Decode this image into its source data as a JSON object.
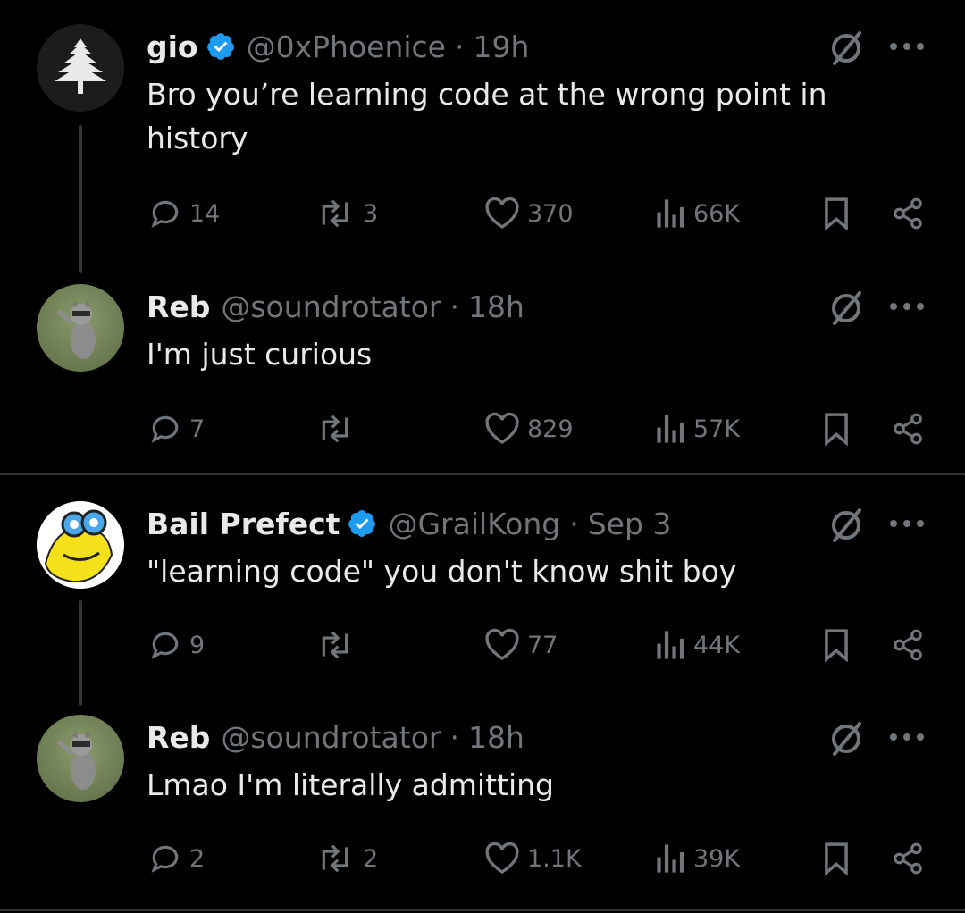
{
  "colors": {
    "background": "#000000",
    "text": "#e7e9ea",
    "muted": "#71767b",
    "verified": "#1d9bf0",
    "divider": "#2f3336"
  },
  "tweets": [
    {
      "name": "gio",
      "handle": "@0xPhoenice",
      "sep": "·",
      "time": "19h",
      "verified": true,
      "text": "Bro you’re learning code at the wrong point in history",
      "avatar": "cedar-tree-avatar",
      "replies": "14",
      "reposts": "3",
      "likes": "370",
      "views": "66K"
    },
    {
      "name": "Reb",
      "handle": "@soundrotator",
      "sep": "·",
      "time": "18h",
      "verified": false,
      "text": "I'm just curious",
      "avatar": "raccoon-avatar",
      "replies": "7",
      "reposts": "",
      "likes": "829",
      "views": "57K"
    },
    {
      "name": "Bail Prefect",
      "handle": "@GrailKong",
      "sep": "·",
      "time": "Sep 3",
      "verified": true,
      "text": "\"learning code\" you don't know shit boy",
      "avatar": "cartoon-avatar",
      "replies": "9",
      "reposts": "",
      "likes": "77",
      "views": "44K"
    },
    {
      "name": "Reb",
      "handle": "@soundrotator",
      "sep": "·",
      "time": "18h",
      "verified": false,
      "text": "Lmao I'm literally admitting",
      "avatar": "raccoon-avatar",
      "replies": "2",
      "reposts": "2",
      "likes": "1.1K",
      "views": "39K"
    }
  ]
}
